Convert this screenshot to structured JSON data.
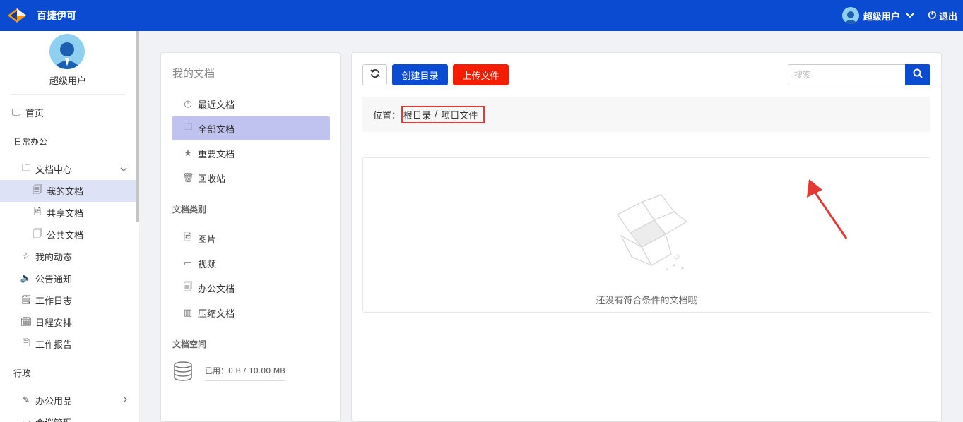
{
  "app": {
    "title": "百捷伊可"
  },
  "header": {
    "user_name": "超级用户",
    "logout_label": "退出"
  },
  "sidebar": {
    "profile_name": "超级用户",
    "home": "首页",
    "group_office": "日常办公",
    "doc_center": "文档中心",
    "my_docs": "我的文档",
    "shared_docs": "共享文档",
    "public_docs": "公共文档",
    "my_activity": "我的动态",
    "announcements": "公告通知",
    "work_log": "工作日志",
    "schedule": "日程安排",
    "work_report": "工作报告",
    "group_admin": "行政",
    "office_supplies": "办公用品",
    "meeting_mgmt": "会议管理"
  },
  "docs_panel": {
    "title": "我的文档",
    "recent": "最近文档",
    "all": "全部文档",
    "important": "重要文档",
    "recycle": "回收站",
    "category_title": "文档类别",
    "images": "图片",
    "videos": "视频",
    "office": "办公文档",
    "archives": "压缩文档",
    "space_title": "文档空间",
    "space_used": "已用：0 B / 10.00 MB"
  },
  "main": {
    "create_dir_label": "创建目录",
    "upload_label": "上传文件",
    "search_placeholder": "搜索",
    "location_label": "位置：",
    "crumb_root": "根目录",
    "crumb_sep": "/",
    "crumb_current": "项目文件",
    "empty_text": "还没有符合条件的文档哦"
  },
  "colors": {
    "brand": "#0a4bd1",
    "danger": "#f51d00",
    "highlight": "#e53935",
    "active_bg": "#c0c3ef"
  }
}
